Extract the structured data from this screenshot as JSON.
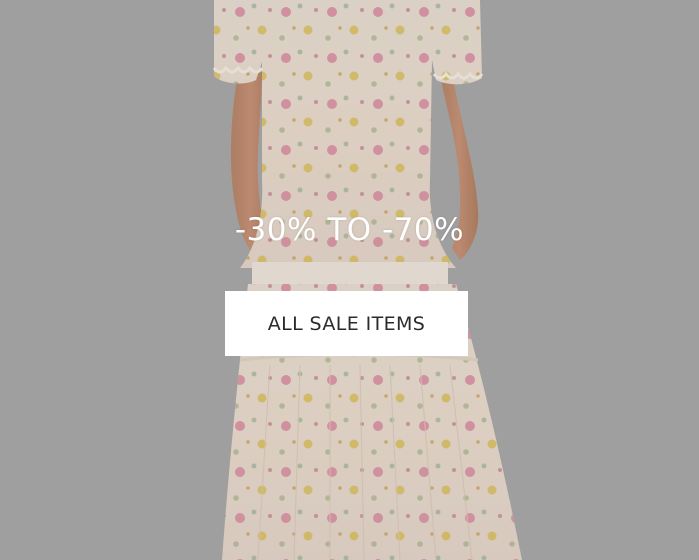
{
  "hero": {
    "headline": "-30% TO -70%",
    "cta_label": "ALL SALE ITEMS",
    "background_color": "#a9a9a9",
    "button_color": "#ffffff",
    "headline_color": "#ffffff"
  },
  "icons": {
    "hero_image": "floral-dress-model-photo"
  }
}
